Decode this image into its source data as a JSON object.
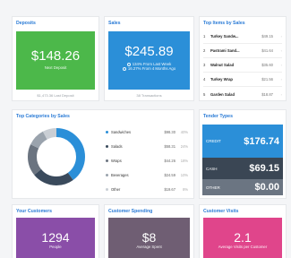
{
  "deposits": {
    "title": "Deposits",
    "amount": "$148.26",
    "label": "Next Deposit",
    "footer": "$1,473.36 Last Deposit",
    "color": "#4cb84a"
  },
  "sales": {
    "title": "Sales",
    "amount": "$245.89",
    "line1": "134% From Last Week",
    "line2": "16.27% From 4 Months Ago",
    "footer": "38 Transactions",
    "color": "#2b8fd8"
  },
  "top_items": {
    "title": "Top Items by Sales",
    "rows": [
      {
        "idx": "1",
        "name": "Turkey Sandw...",
        "price": "$49.15"
      },
      {
        "idx": "2",
        "name": "Pastrami Sand...",
        "price": "$41.64"
      },
      {
        "idx": "3",
        "name": "Walnut Salad",
        "price": "$35.60"
      },
      {
        "idx": "4",
        "name": "Turkey Wrap",
        "price": "$21.56"
      },
      {
        "idx": "5",
        "name": "Garden Salad",
        "price": "$18.87"
      }
    ]
  },
  "top_categories": {
    "title": "Top Categories by Sales",
    "rows": [
      {
        "name": "Sandwiches",
        "value": "$98.30",
        "pct": "40%",
        "color": "#2b8fd8"
      },
      {
        "name": "Salads",
        "value": "$58.31",
        "pct": "24%",
        "color": "#3a4a5c"
      },
      {
        "name": "Wraps",
        "value": "$44.26",
        "pct": "18%",
        "color": "#6b7480"
      },
      {
        "name": "Beverages",
        "value": "$24.59",
        "pct": "10%",
        "color": "#9aa3ad"
      },
      {
        "name": "Other",
        "value": "$19.67",
        "pct": "8%",
        "color": "#c9ced4"
      }
    ]
  },
  "tender_types": {
    "title": "Tender Types",
    "rows": [
      {
        "label": "CREDIT",
        "amount": "$176.74",
        "color": "#2b8fd8"
      },
      {
        "label": "CASH",
        "amount": "$69.15",
        "color": "#3a4654"
      },
      {
        "label": "OTHER",
        "amount": "$0.00",
        "color": "#6b7582"
      }
    ]
  },
  "your_customers": {
    "title": "Your Customers",
    "amount": "1294",
    "label": "People",
    "color": "#8a4ea8"
  },
  "customer_spending": {
    "title": "Customer Spending",
    "amount": "$8",
    "label": "Average Spent",
    "color": "#6f5e73"
  },
  "customer_visits": {
    "title": "Customer Visits",
    "amount": "2.1",
    "label": "Average Visits per Customer",
    "color": "#e0458b"
  }
}
